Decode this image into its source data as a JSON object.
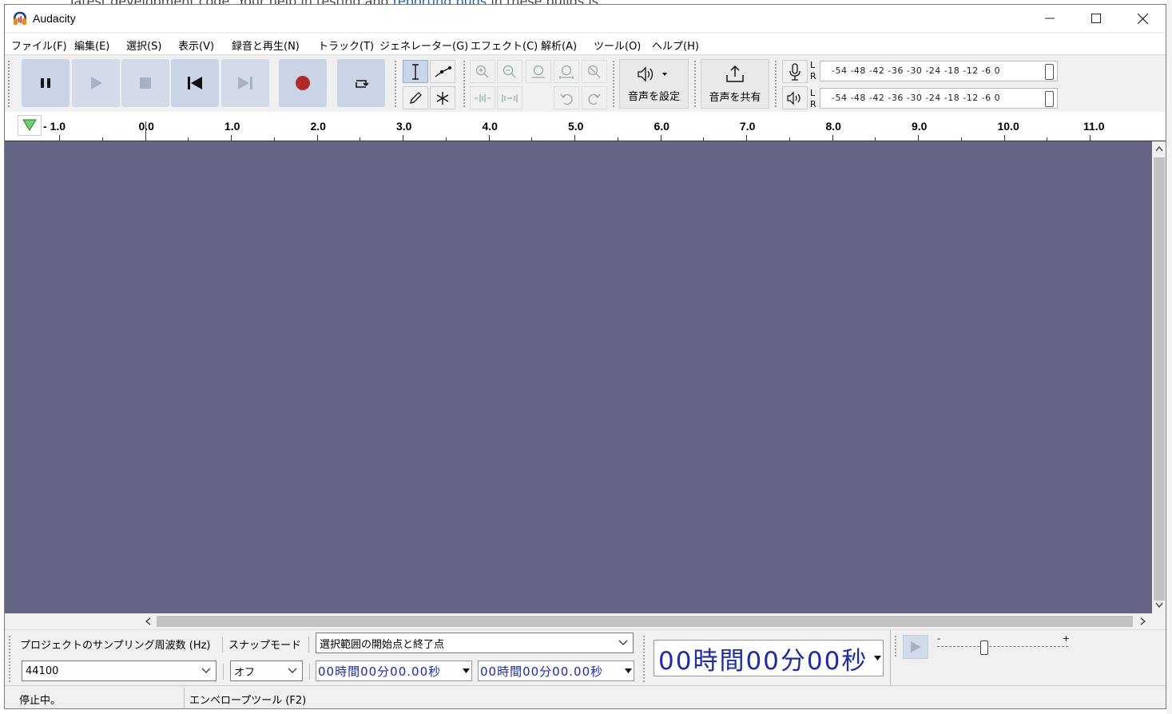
{
  "background_page": {
    "text_before": "latest development code. Your help in testing and ",
    "link": "reporting bugs",
    "text_after": " in these builds is"
  },
  "window": {
    "title": "Audacity"
  },
  "menu": [
    "ファイル(F)",
    "編集(E)",
    "選択(S)",
    "表示(V)",
    "録音と再生(N)",
    "トラック(T)",
    "ジェネレーター(G)",
    "エフェクト(C)",
    "解析(A)",
    "ツール(O)",
    "ヘルプ(H)"
  ],
  "toolbar": {
    "audio_setup_label": "音声を設定",
    "share_audio_label": "音声を共有",
    "meter_scale": "-54 -48 -42 -36 -30 -24 -18 -12  -6  0",
    "meter_channels": [
      "L",
      "R"
    ]
  },
  "ruler": {
    "labels": [
      "- 1.0",
      "0.0",
      "1.0",
      "2.0",
      "3.0",
      "4.0",
      "5.0",
      "6.0",
      "7.0",
      "8.0",
      "9.0",
      "10.0",
      "11.0"
    ]
  },
  "bottom": {
    "project_rate_label": "プロジェクトのサンプリング周波数 (Hz)",
    "project_rate_value": "44100",
    "snap_label": "スナップモード",
    "snap_value": "オフ",
    "selection_mode": "選択範囲の開始点と終了点",
    "sel_start": "00時間00分00.00秒",
    "sel_end": "00時間00分00.00秒",
    "audio_position": "00時間00分00秒",
    "speed_minus": "-",
    "speed_plus": "+"
  },
  "status": {
    "state": "停止中。",
    "tool_hint": "エンベロープツール (F2)"
  },
  "colors": {
    "track_bg": "#646584",
    "button_blue": "#c9d4e6",
    "record_red": "#b32a2a",
    "time_blue": "#1a2ab5"
  }
}
